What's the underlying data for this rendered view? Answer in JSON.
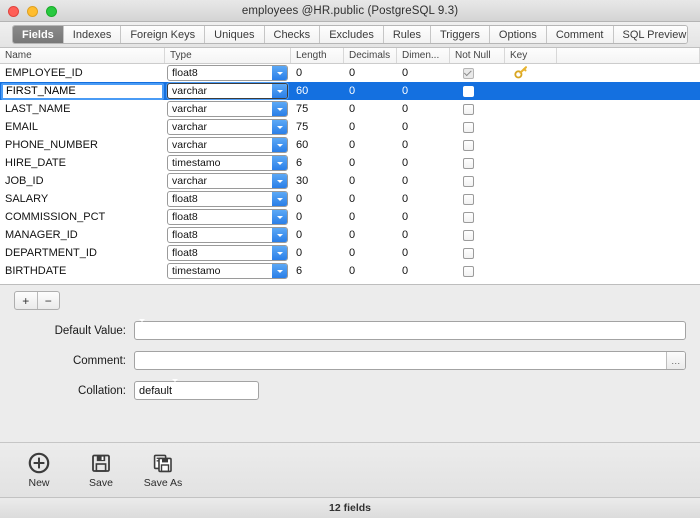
{
  "window": {
    "title": "employees @HR.public (PostgreSQL 9.3)",
    "traffic": {
      "close": "close-button",
      "minimize": "minimize-button",
      "zoom": "zoom-button"
    }
  },
  "tabs": [
    {
      "label": "Fields",
      "active": true
    },
    {
      "label": "Indexes",
      "active": false
    },
    {
      "label": "Foreign Keys",
      "active": false
    },
    {
      "label": "Uniques",
      "active": false
    },
    {
      "label": "Checks",
      "active": false
    },
    {
      "label": "Excludes",
      "active": false
    },
    {
      "label": "Rules",
      "active": false
    },
    {
      "label": "Triggers",
      "active": false
    },
    {
      "label": "Options",
      "active": false
    },
    {
      "label": "Comment",
      "active": false
    },
    {
      "label": "SQL Preview",
      "active": false
    }
  ],
  "grid": {
    "columns": [
      "Name",
      "Type",
      "Length",
      "Decimals",
      "Dimen...",
      "Not Null",
      "Key",
      ""
    ],
    "rows": [
      {
        "name": "EMPLOYEE_ID",
        "type": "float8",
        "length": "0",
        "decimals": "0",
        "dimension": "0",
        "notnull": true,
        "key": "primary-key",
        "selected": false
      },
      {
        "name": "FIRST_NAME",
        "type": "varchar",
        "length": "60",
        "decimals": "0",
        "dimension": "0",
        "notnull": false,
        "key": "",
        "selected": true
      },
      {
        "name": "LAST_NAME",
        "type": "varchar",
        "length": "75",
        "decimals": "0",
        "dimension": "0",
        "notnull": false,
        "key": "",
        "selected": false
      },
      {
        "name": "EMAIL",
        "type": "varchar",
        "length": "75",
        "decimals": "0",
        "dimension": "0",
        "notnull": false,
        "key": "",
        "selected": false
      },
      {
        "name": "PHONE_NUMBER",
        "type": "varchar",
        "length": "60",
        "decimals": "0",
        "dimension": "0",
        "notnull": false,
        "key": "",
        "selected": false
      },
      {
        "name": "HIRE_DATE",
        "type": "timestamo",
        "length": "6",
        "decimals": "0",
        "dimension": "0",
        "notnull": false,
        "key": "",
        "selected": false
      },
      {
        "name": "JOB_ID",
        "type": "varchar",
        "length": "30",
        "decimals": "0",
        "dimension": "0",
        "notnull": false,
        "key": "",
        "selected": false
      },
      {
        "name": "SALARY",
        "type": "float8",
        "length": "0",
        "decimals": "0",
        "dimension": "0",
        "notnull": false,
        "key": "",
        "selected": false
      },
      {
        "name": "COMMISSION_PCT",
        "type": "float8",
        "length": "0",
        "decimals": "0",
        "dimension": "0",
        "notnull": false,
        "key": "",
        "selected": false
      },
      {
        "name": "MANAGER_ID",
        "type": "float8",
        "length": "0",
        "decimals": "0",
        "dimension": "0",
        "notnull": false,
        "key": "",
        "selected": false
      },
      {
        "name": "DEPARTMENT_ID",
        "type": "float8",
        "length": "0",
        "decimals": "0",
        "dimension": "0",
        "notnull": false,
        "key": "",
        "selected": false
      },
      {
        "name": "BIRTHDATE",
        "type": "timestamo",
        "length": "6",
        "decimals": "0",
        "dimension": "0",
        "notnull": false,
        "key": "",
        "selected": false
      }
    ]
  },
  "rowbuttons": {
    "add": "+",
    "remove": "−"
  },
  "form": {
    "default_value": {
      "label": "Default Value:",
      "value": "",
      "placeholder": ""
    },
    "comment": {
      "label": "Comment:",
      "value": "",
      "placeholder": ""
    },
    "collation": {
      "label": "Collation:",
      "value": "default",
      "options": [
        "default"
      ]
    },
    "dots": "..."
  },
  "toolbar": [
    {
      "label": "New",
      "icon": "new-icon"
    },
    {
      "label": "Save",
      "icon": "save-icon"
    },
    {
      "label": "Save As",
      "icon": "save-as-icon"
    }
  ],
  "status": {
    "text": "12 fields"
  },
  "colors": {
    "selection": "#1470e0",
    "accent": "#2a7ee8",
    "key": "#e8b430",
    "window_bg": "#ececec"
  }
}
